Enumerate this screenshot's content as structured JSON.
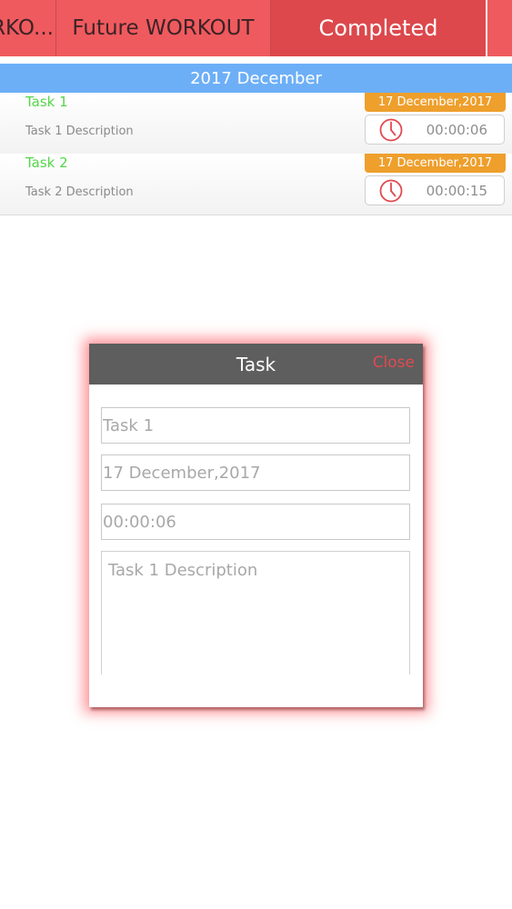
{
  "tabs": [
    {
      "label": "RKO..."
    },
    {
      "label": "Future WORKOUT"
    },
    {
      "label": "Completed"
    },
    {
      "label": ""
    }
  ],
  "section": {
    "title": "2017 December"
  },
  "tasks": [
    {
      "name": "Task 1",
      "description": "Task  1 Description",
      "date": "17 December,2017",
      "time": "00:00:06"
    },
    {
      "name": "Task 2",
      "description": "Task 2 Description",
      "date": "17 December,2017",
      "time": "00:00:15"
    }
  ],
  "modal": {
    "title": "Task",
    "close_label": "Close",
    "name_value": "Task 1",
    "date_value": "17 December,2017",
    "time_value": "00:00:06",
    "description_value": "Task  1 Description"
  },
  "colors": {
    "tab_bar": "#ef5a5e",
    "tab_active": "#dc484c",
    "section_header": "#6daff7",
    "task_name": "#55d64a",
    "date_badge": "#ee9f2c",
    "clock_icon": "#e04a50",
    "modal_header": "#5e5e5e"
  }
}
